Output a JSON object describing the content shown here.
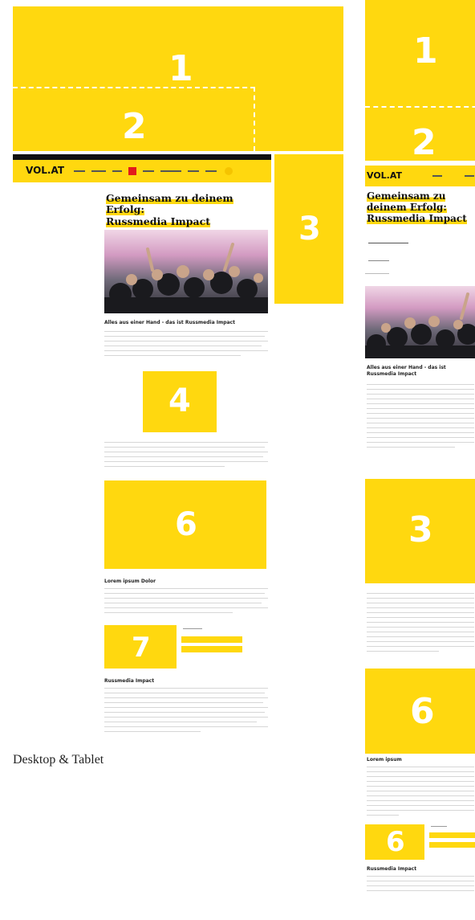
{
  "caption": "Desktop & Tablet",
  "zones": {
    "z1": "1",
    "z2": "2",
    "z3": "3",
    "z4": "4",
    "z6": "6",
    "z7": "7"
  },
  "desktop": {
    "logo": "VOL.AT",
    "headline_line1": "Gemeinsam zu deinem Erfolg:",
    "headline_line2": "Russmedia Impact",
    "subheadline": "Alles aus einer Hand - das ist Russmedia Impact",
    "section_title_1": "Lorem ipsum Dolor",
    "section_title_2": "Russmedia Impact"
  },
  "tablet": {
    "logo": "VOL.AT",
    "headline_line1": "Gemeinsam zu",
    "headline_line2": "deinem Erfolg:",
    "headline_line3": "Russmedia Impact",
    "subheadline_line1": "Alles aus einer Hand - das ist",
    "subheadline_line2": "Russmedia Impact",
    "section_title_1": "Lorem ipsum",
    "section_title_2": "Russmedia Impact",
    "zones": {
      "t1": "1",
      "t2": "2",
      "t3": "3",
      "t6a": "6",
      "t6b": "6"
    }
  },
  "colors": {
    "accent": "#FFD80F",
    "nav": "#111111"
  }
}
